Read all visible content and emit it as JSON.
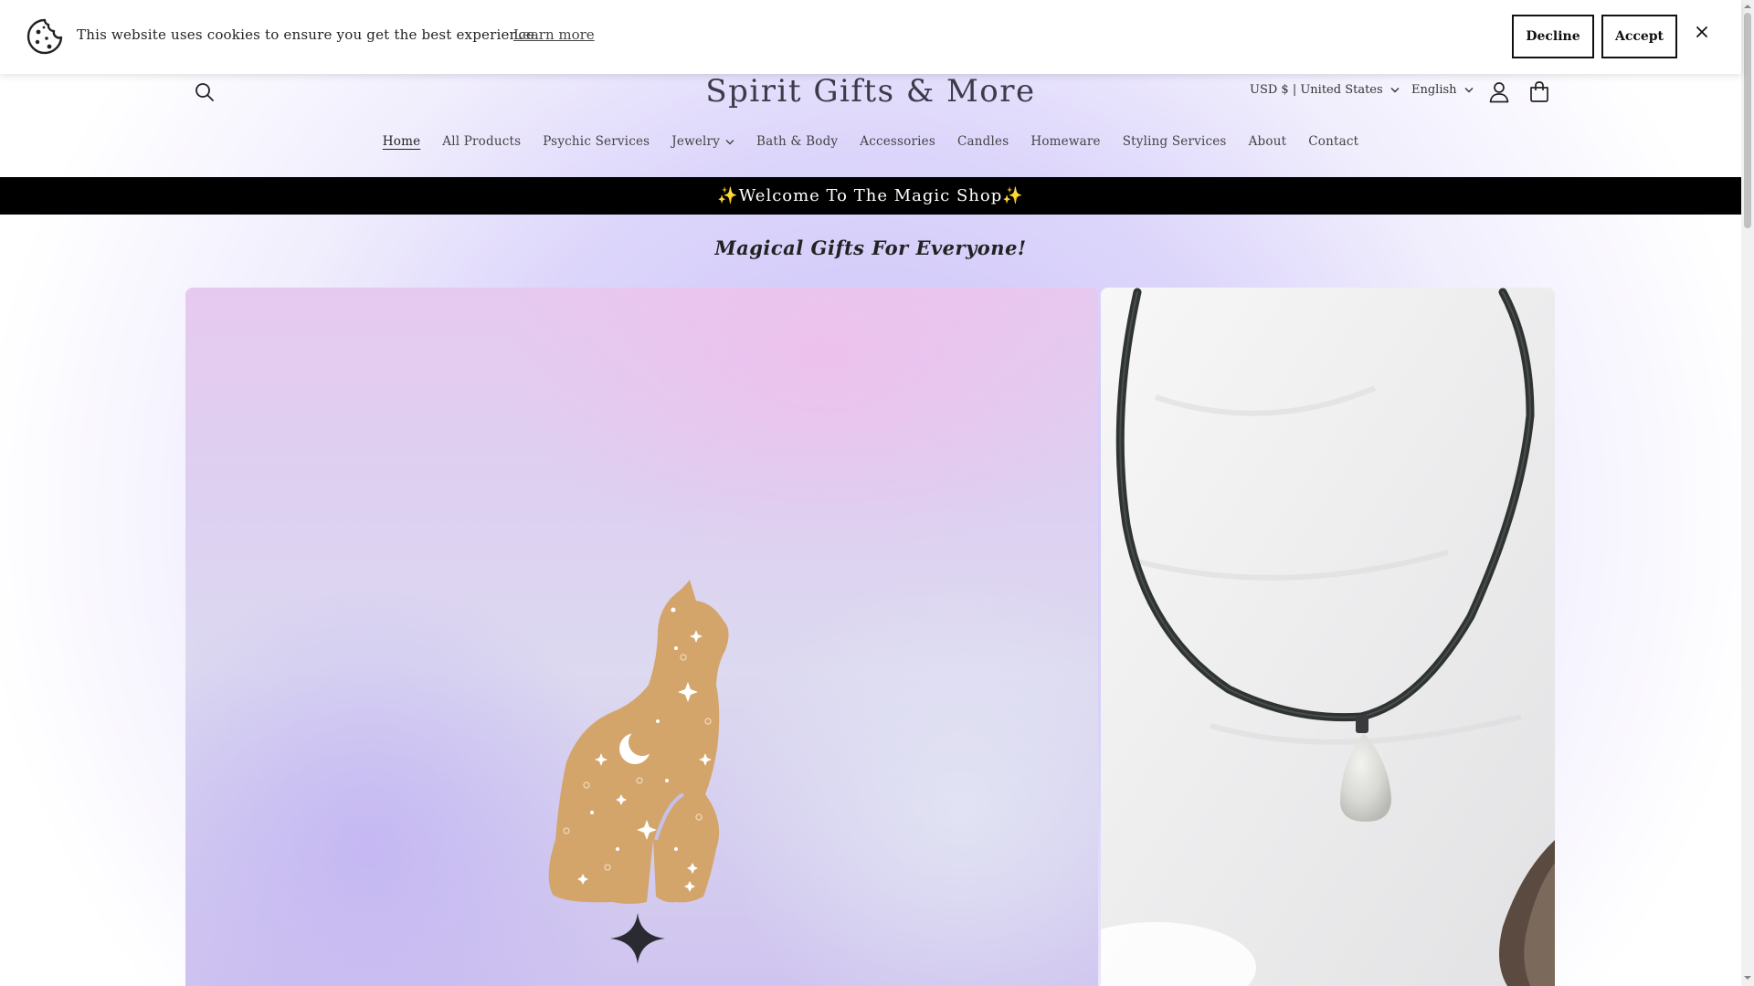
{
  "cookie": {
    "message": "This website uses cookies to ensure you get the best experience.",
    "learn_more": "Learn more",
    "decline": "Decline",
    "accept": "Accept"
  },
  "header": {
    "site_title": "Spirit Gifts & More",
    "currency": "USD $ | United States",
    "language": "English"
  },
  "nav": {
    "items": [
      {
        "label": "Home",
        "active": true,
        "has_dropdown": false
      },
      {
        "label": "All Products",
        "active": false,
        "has_dropdown": false
      },
      {
        "label": "Psychic Services",
        "active": false,
        "has_dropdown": false
      },
      {
        "label": "Jewelry",
        "active": false,
        "has_dropdown": true
      },
      {
        "label": "Bath & Body",
        "active": false,
        "has_dropdown": false
      },
      {
        "label": "Accessories",
        "active": false,
        "has_dropdown": false
      },
      {
        "label": "Candles",
        "active": false,
        "has_dropdown": false
      },
      {
        "label": "Homeware",
        "active": false,
        "has_dropdown": false
      },
      {
        "label": "Styling Services",
        "active": false,
        "has_dropdown": false
      },
      {
        "label": "About",
        "active": false,
        "has_dropdown": false
      },
      {
        "label": "Contact",
        "active": false,
        "has_dropdown": false
      }
    ]
  },
  "announcement": "✨Welcome To The Magic Shop✨",
  "tagline": "Magical Gifts For Everyone!",
  "icons": {
    "cookie": "cookie-icon",
    "close": "close-icon",
    "search": "search-icon",
    "account": "user-icon",
    "cart": "bag-icon",
    "chevron": "chevron-down-icon"
  },
  "colors": {
    "announcement_bg": "#000000",
    "cat_fill": "#d3a56b",
    "background_glow": "#c9c0f7"
  }
}
